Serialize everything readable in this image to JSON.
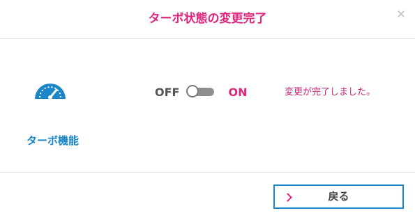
{
  "dialog": {
    "title": "ターボ状態の変更完了",
    "close_icon": "close-icon"
  },
  "feature": {
    "icon": "speedometer-icon",
    "label": "ターボ機能",
    "icon_color": "#1b86c8"
  },
  "toggle": {
    "off_label": "OFF",
    "on_label": "ON",
    "state": "off"
  },
  "message": {
    "text": "変更が完了しました。"
  },
  "footer": {
    "back_label": "戻る",
    "chevron_icon": "chevron-right-icon"
  },
  "colors": {
    "accent": "#e0267f",
    "primary": "#1b86c8"
  }
}
